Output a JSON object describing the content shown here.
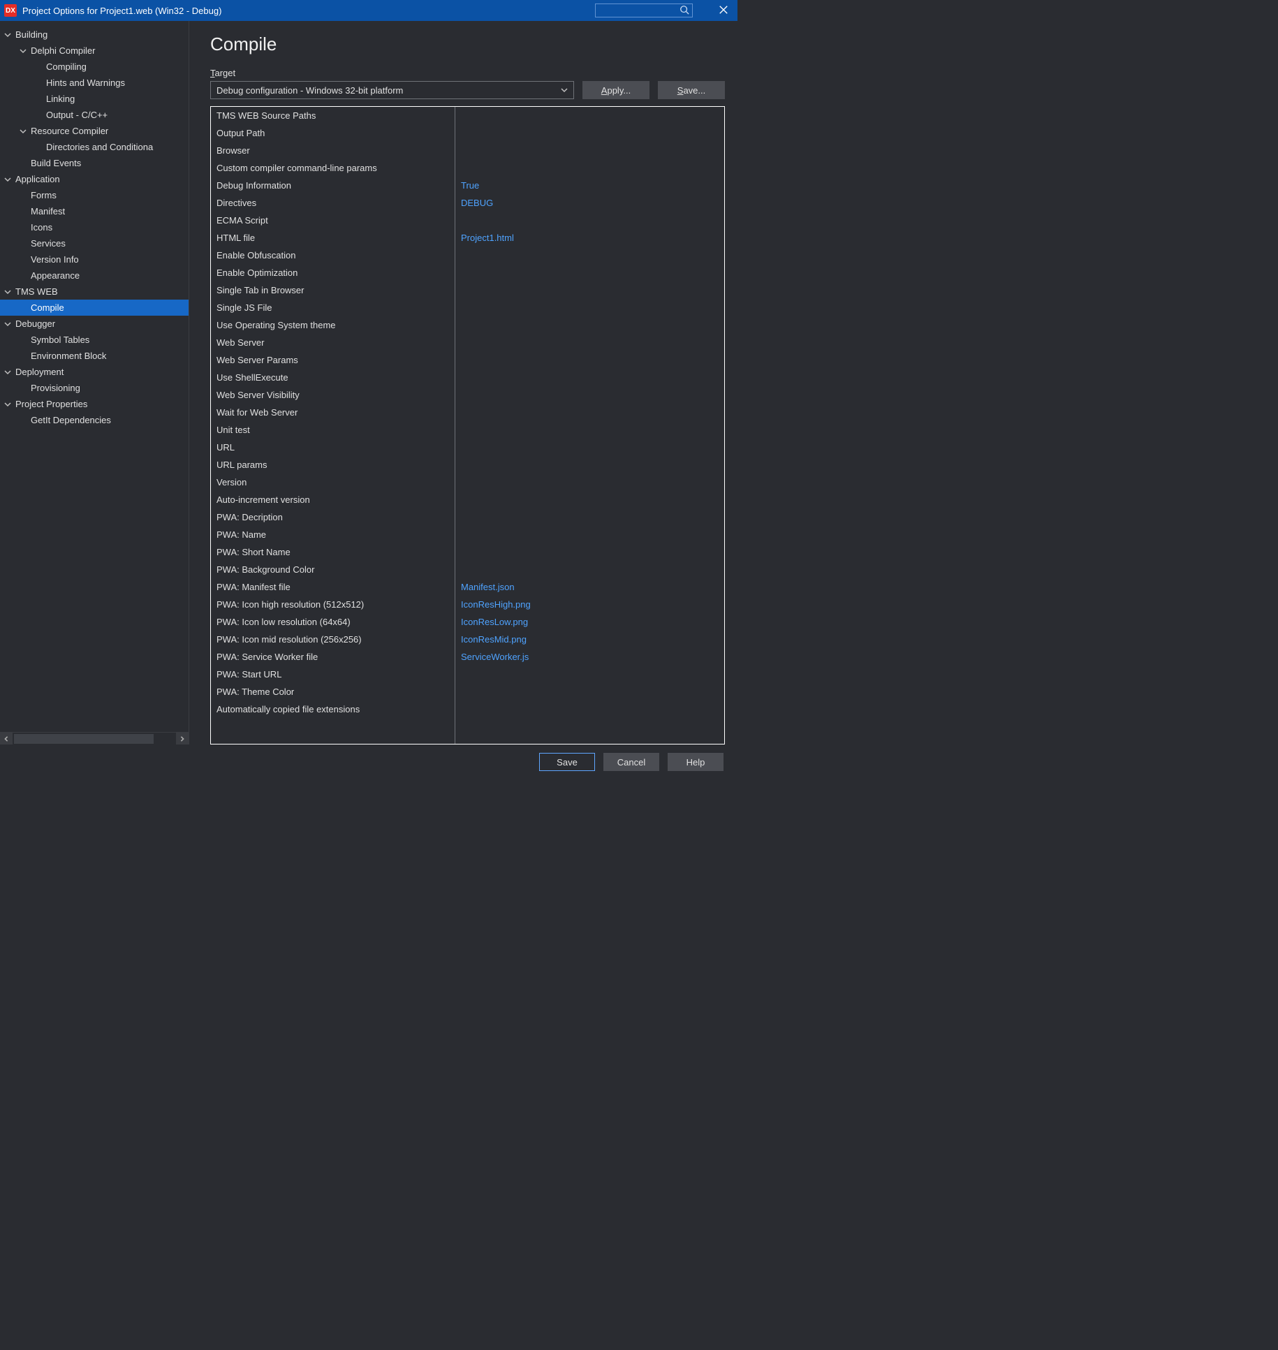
{
  "window": {
    "app_icon_text": "DX",
    "title": "Project Options for Project1.web  (Win32 - Debug)"
  },
  "sidebar": {
    "items": [
      {
        "label": "Building",
        "depth": 0,
        "chev": "down"
      },
      {
        "label": "Delphi Compiler",
        "depth": 1,
        "chev": "down"
      },
      {
        "label": "Compiling",
        "depth": 2,
        "chev": ""
      },
      {
        "label": "Hints and Warnings",
        "depth": 2,
        "chev": ""
      },
      {
        "label": "Linking",
        "depth": 2,
        "chev": ""
      },
      {
        "label": "Output - C/C++",
        "depth": 2,
        "chev": ""
      },
      {
        "label": "Resource Compiler",
        "depth": 1,
        "chev": "down"
      },
      {
        "label": "Directories and Conditiona",
        "depth": 2,
        "chev": ""
      },
      {
        "label": "Build Events",
        "depth": 1,
        "chev": ""
      },
      {
        "label": "Application",
        "depth": 0,
        "chev": "down"
      },
      {
        "label": "Forms",
        "depth": 1,
        "chev": ""
      },
      {
        "label": "Manifest",
        "depth": 1,
        "chev": ""
      },
      {
        "label": "Icons",
        "depth": 1,
        "chev": ""
      },
      {
        "label": "Services",
        "depth": 1,
        "chev": ""
      },
      {
        "label": "Version Info",
        "depth": 1,
        "chev": ""
      },
      {
        "label": "Appearance",
        "depth": 1,
        "chev": ""
      },
      {
        "label": "TMS WEB",
        "depth": 0,
        "chev": "down"
      },
      {
        "label": "Compile",
        "depth": 1,
        "chev": "",
        "selected": true
      },
      {
        "label": "Debugger",
        "depth": 0,
        "chev": "down"
      },
      {
        "label": "Symbol Tables",
        "depth": 1,
        "chev": ""
      },
      {
        "label": "Environment Block",
        "depth": 1,
        "chev": ""
      },
      {
        "label": "Deployment",
        "depth": 0,
        "chev": "down"
      },
      {
        "label": "Provisioning",
        "depth": 1,
        "chev": ""
      },
      {
        "label": "Project Properties",
        "depth": 0,
        "chev": "down"
      },
      {
        "label": "GetIt Dependencies",
        "depth": 1,
        "chev": ""
      }
    ]
  },
  "page": {
    "title": "Compile",
    "target_label_pre": "",
    "target_label_ul": "T",
    "target_label_post": "arget",
    "target_value": "Debug configuration - Windows 32-bit platform",
    "apply_pre": "",
    "apply_ul": "A",
    "apply_post": "pply...",
    "save_ul": "S",
    "save_post": "ave..."
  },
  "properties": [
    {
      "name": "TMS WEB Source Paths",
      "value": ""
    },
    {
      "name": "Output Path",
      "value": ""
    },
    {
      "name": "Browser",
      "value": ""
    },
    {
      "name": "Custom compiler command-line params",
      "value": ""
    },
    {
      "name": "Debug Information",
      "value": "True"
    },
    {
      "name": "Directives",
      "value": "DEBUG"
    },
    {
      "name": "ECMA Script",
      "value": ""
    },
    {
      "name": "HTML file",
      "value": "Project1.html"
    },
    {
      "name": "Enable Obfuscation",
      "value": ""
    },
    {
      "name": "Enable Optimization",
      "value": ""
    },
    {
      "name": "Single Tab in Browser",
      "value": ""
    },
    {
      "name": "Single JS File",
      "value": ""
    },
    {
      "name": "Use Operating System theme",
      "value": ""
    },
    {
      "name": "Web Server",
      "value": ""
    },
    {
      "name": "Web Server Params",
      "value": ""
    },
    {
      "name": "Use ShellExecute",
      "value": ""
    },
    {
      "name": "Web Server Visibility",
      "value": ""
    },
    {
      "name": "Wait for Web Server",
      "value": ""
    },
    {
      "name": "Unit test",
      "value": ""
    },
    {
      "name": "URL",
      "value": ""
    },
    {
      "name": "URL params",
      "value": ""
    },
    {
      "name": "Version",
      "value": ""
    },
    {
      "name": "Auto-increment version",
      "value": ""
    },
    {
      "name": "PWA: Decription",
      "value": ""
    },
    {
      "name": "PWA: Name",
      "value": ""
    },
    {
      "name": "PWA: Short Name",
      "value": ""
    },
    {
      "name": "PWA: Background Color",
      "value": ""
    },
    {
      "name": "PWA: Manifest file",
      "value": "Manifest.json"
    },
    {
      "name": "PWA: Icon high resolution (512x512)",
      "value": "IconResHigh.png"
    },
    {
      "name": "PWA: Icon low resolution (64x64)",
      "value": "IconResLow.png"
    },
    {
      "name": "PWA: Icon mid resolution (256x256)",
      "value": "IconResMid.png"
    },
    {
      "name": "PWA: Service Worker file",
      "value": "ServiceWorker.js"
    },
    {
      "name": "PWA: Start URL",
      "value": ""
    },
    {
      "name": "PWA: Theme Color",
      "value": ""
    },
    {
      "name": "Automatically copied file extensions",
      "value": ""
    }
  ],
  "footer": {
    "save": "Save",
    "cancel": "Cancel",
    "help": "Help"
  }
}
